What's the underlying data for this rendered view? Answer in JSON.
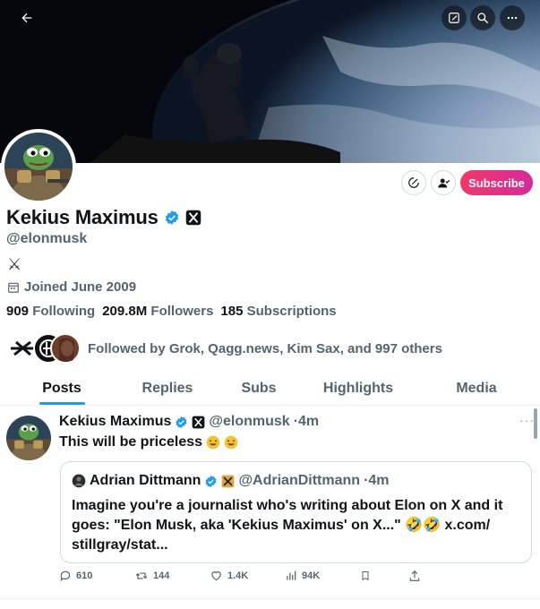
{
  "header": {
    "back_icon": "arrow-left-icon",
    "edit_icon": "edit-square-icon",
    "search_icon": "search-icon",
    "more_icon": "more-horizontal-icon"
  },
  "profile": {
    "name": "Kekius Maximus",
    "handle": "@elonmusk",
    "bio": "⚔",
    "joined": "Joined June 2009",
    "subscribe_label": "Subscribe",
    "stats": {
      "following_count": "909",
      "following_label": "Following",
      "followers_count": "209.8M",
      "followers_label": "Followers",
      "subscriptions_count": "185",
      "subscriptions_label": "Subscriptions"
    },
    "followed_by": "Followed by Grok, Qagg.news, Kim Sax, and 997 others"
  },
  "tabs": [
    {
      "label": "Posts"
    },
    {
      "label": "Replies"
    },
    {
      "label": "Subs"
    },
    {
      "label": "Highlights"
    },
    {
      "label": "Media"
    }
  ],
  "post": {
    "author_name": "Kekius Maximus",
    "author_handle": "@elonmusk",
    "time": "·4m",
    "text": "This will be priceless",
    "quote": {
      "author_name": "Adrian Dittmann",
      "author_handle": "@AdrianDittmann",
      "time": "·4m",
      "text": "Imagine you're a journalist who's writing about Elon on X and it goes: \"Elon Musk, aka 'Kekius Maximus' on X...\" 🤣🤣 x.com/ stillgray/stat..."
    },
    "actions": {
      "replies": "610",
      "reposts": "144",
      "likes": "1.4K",
      "views": "94K"
    }
  },
  "colors": {
    "accent": "#1d9bf0",
    "subscribe_start": "#f0386b",
    "subscribe_end": "#d42b9c",
    "muted": "#536471"
  }
}
